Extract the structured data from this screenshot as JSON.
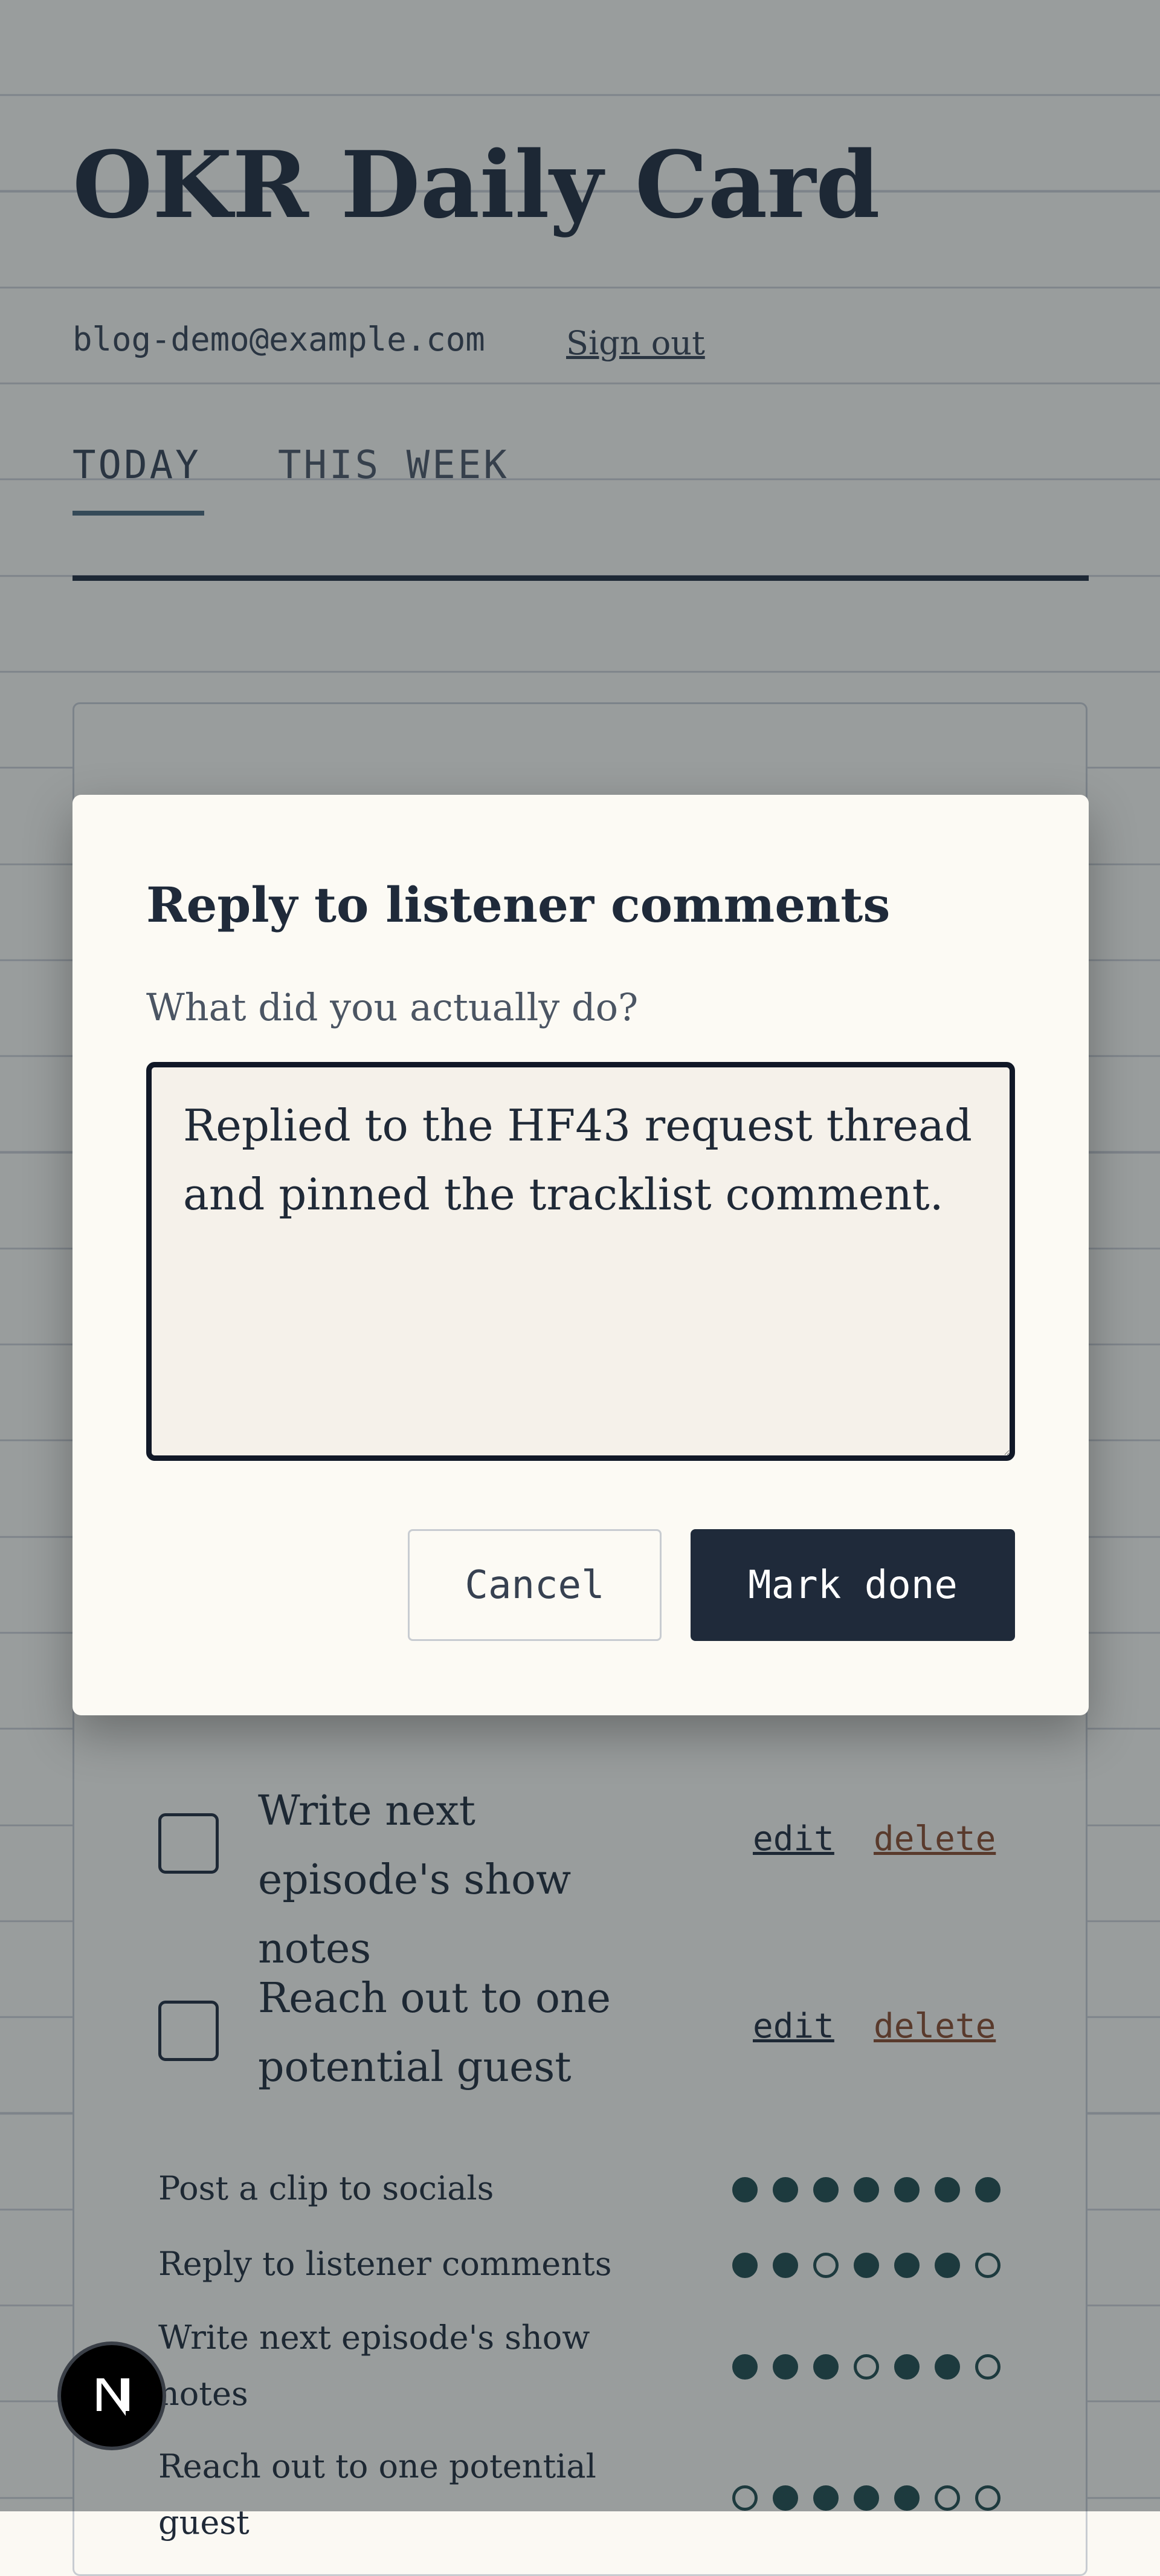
{
  "header": {
    "title": "OKR Daily Card",
    "email": "blog-demo@example.com",
    "sign_out": "Sign out"
  },
  "tabs": [
    {
      "label": "TODAY",
      "active": true
    },
    {
      "label": "THIS WEEK",
      "active": false
    }
  ],
  "tasks": [
    {
      "label": "Write next episode's show notes",
      "edit": "edit",
      "delete": "delete",
      "checked": false
    },
    {
      "label": "Reach out to one potential guest",
      "edit": "edit",
      "delete": "delete",
      "checked": false
    }
  ],
  "week_stats": [
    {
      "label": "Post a clip to socials",
      "days": [
        1,
        1,
        1,
        1,
        1,
        1,
        1
      ]
    },
    {
      "label": "Reply to listener comments",
      "days": [
        1,
        1,
        0,
        1,
        1,
        1,
        0
      ]
    },
    {
      "label": "Write next episode's show notes",
      "days": [
        1,
        1,
        1,
        0,
        1,
        1,
        0
      ]
    },
    {
      "label": "Reach out to one potential guest",
      "days": [
        0,
        1,
        1,
        1,
        1,
        0,
        0
      ]
    }
  ],
  "modal": {
    "title": "Reply to listener comments",
    "prompt": "What did you actually do?",
    "text_value": "Replied to the HF43 request thread and pinned the tracklist comment.",
    "cancel_label": "Cancel",
    "done_label": "Mark done"
  },
  "colors": {
    "ink": "#1f2a3a",
    "accent_tab": "#4a6778",
    "delete_link": "#8a4a2a",
    "dot_fill": "#1f4a4a"
  }
}
